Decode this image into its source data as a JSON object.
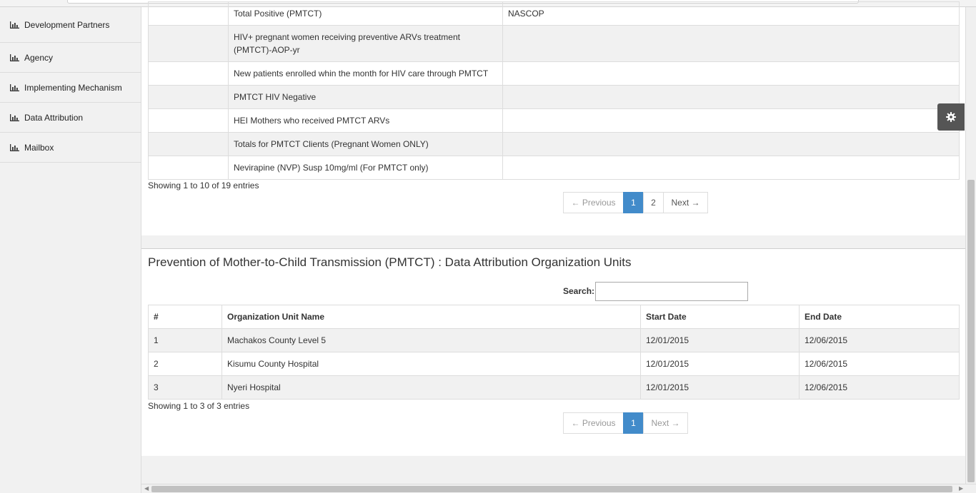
{
  "sidebar": {
    "items": [
      {
        "label": "Development Partners",
        "icon": "bar-chart-icon"
      },
      {
        "label": "Agency",
        "icon": "bar-chart-icon"
      },
      {
        "label": "Implementing Mechanism",
        "icon": "bar-chart-icon"
      },
      {
        "label": "Data Attribution",
        "icon": "bar-chart-icon"
      },
      {
        "label": "Mailbox",
        "icon": "bar-chart-icon"
      }
    ]
  },
  "indicators": {
    "rows": [
      {
        "name": "Total Positive (PMTCT)",
        "source": "NASCOP"
      },
      {
        "name": "HIV+ pregnant women receiving preventive ARVs treatment (PMTCT)-AOP-yr",
        "source": ""
      },
      {
        "name": "New patients enrolled whin the month for HIV care through PMTCT",
        "source": ""
      },
      {
        "name": "PMTCT HIV Negative",
        "source": ""
      },
      {
        "name": "HEI Mothers who received PMTCT ARVs",
        "source": ""
      },
      {
        "name": "Totals for PMTCT Clients (Pregnant Women ONLY)",
        "source": ""
      },
      {
        "name": "Nevirapine (NVP) Susp 10mg/ml (For PMTCT only)",
        "source": ""
      }
    ],
    "info": "Showing 1 to 10 of 19 entries",
    "pager": {
      "previous": "← Previous",
      "pages": [
        "1",
        "2"
      ],
      "next": "Next →",
      "current": "1"
    }
  },
  "org_units": {
    "title": "Prevention of Mother-to-Child Transmission (PMTCT) : Data Attribution Organization Units",
    "search_label": "Search:",
    "search_value": "",
    "columns": [
      "#",
      "Organization Unit Name",
      "Start Date",
      "End Date"
    ],
    "rows": [
      {
        "num": "1",
        "name": "Machakos County Level 5",
        "start": "12/01/2015",
        "end": "12/06/2015"
      },
      {
        "num": "2",
        "name": "Kisumu County Hospital",
        "start": "12/01/2015",
        "end": "12/06/2015"
      },
      {
        "num": "3",
        "name": "Nyeri Hospital",
        "start": "12/01/2015",
        "end": "12/06/2015"
      }
    ],
    "info": "Showing 1 to 3 of 3 entries",
    "pager": {
      "previous": "← Previous",
      "pages": [
        "1"
      ],
      "next": "Next →",
      "current": "1"
    }
  },
  "settings": {
    "icon": "gear-icon"
  },
  "colors": {
    "accent": "#428bca",
    "gear_bg": "#555555"
  }
}
